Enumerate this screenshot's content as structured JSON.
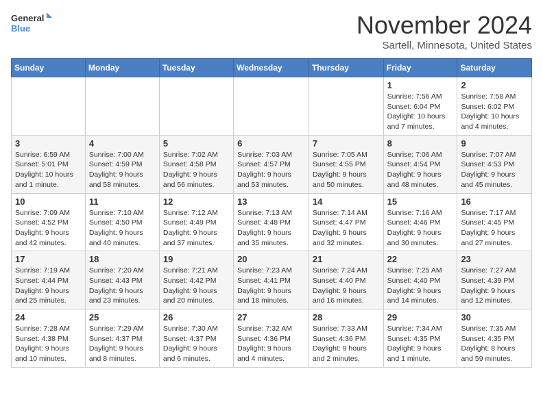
{
  "header": {
    "logo_general": "General",
    "logo_blue": "Blue",
    "month_title": "November 2024",
    "location": "Sartell, Minnesota, United States"
  },
  "days_of_week": [
    "Sunday",
    "Monday",
    "Tuesday",
    "Wednesday",
    "Thursday",
    "Friday",
    "Saturday"
  ],
  "weeks": [
    [
      {
        "num": "",
        "info": ""
      },
      {
        "num": "",
        "info": ""
      },
      {
        "num": "",
        "info": ""
      },
      {
        "num": "",
        "info": ""
      },
      {
        "num": "",
        "info": ""
      },
      {
        "num": "1",
        "info": "Sunrise: 7:56 AM\nSunset: 6:04 PM\nDaylight: 10 hours and 7 minutes."
      },
      {
        "num": "2",
        "info": "Sunrise: 7:58 AM\nSunset: 6:02 PM\nDaylight: 10 hours and 4 minutes."
      }
    ],
    [
      {
        "num": "3",
        "info": "Sunrise: 6:59 AM\nSunset: 5:01 PM\nDaylight: 10 hours and 1 minute."
      },
      {
        "num": "4",
        "info": "Sunrise: 7:00 AM\nSunset: 4:59 PM\nDaylight: 9 hours and 58 minutes."
      },
      {
        "num": "5",
        "info": "Sunrise: 7:02 AM\nSunset: 4:58 PM\nDaylight: 9 hours and 56 minutes."
      },
      {
        "num": "6",
        "info": "Sunrise: 7:03 AM\nSunset: 4:57 PM\nDaylight: 9 hours and 53 minutes."
      },
      {
        "num": "7",
        "info": "Sunrise: 7:05 AM\nSunset: 4:55 PM\nDaylight: 9 hours and 50 minutes."
      },
      {
        "num": "8",
        "info": "Sunrise: 7:06 AM\nSunset: 4:54 PM\nDaylight: 9 hours and 48 minutes."
      },
      {
        "num": "9",
        "info": "Sunrise: 7:07 AM\nSunset: 4:53 PM\nDaylight: 9 hours and 45 minutes."
      }
    ],
    [
      {
        "num": "10",
        "info": "Sunrise: 7:09 AM\nSunset: 4:52 PM\nDaylight: 9 hours and 42 minutes."
      },
      {
        "num": "11",
        "info": "Sunrise: 7:10 AM\nSunset: 4:50 PM\nDaylight: 9 hours and 40 minutes."
      },
      {
        "num": "12",
        "info": "Sunrise: 7:12 AM\nSunset: 4:49 PM\nDaylight: 9 hours and 37 minutes."
      },
      {
        "num": "13",
        "info": "Sunrise: 7:13 AM\nSunset: 4:48 PM\nDaylight: 9 hours and 35 minutes."
      },
      {
        "num": "14",
        "info": "Sunrise: 7:14 AM\nSunset: 4:47 PM\nDaylight: 9 hours and 32 minutes."
      },
      {
        "num": "15",
        "info": "Sunrise: 7:16 AM\nSunset: 4:46 PM\nDaylight: 9 hours and 30 minutes."
      },
      {
        "num": "16",
        "info": "Sunrise: 7:17 AM\nSunset: 4:45 PM\nDaylight: 9 hours and 27 minutes."
      }
    ],
    [
      {
        "num": "17",
        "info": "Sunrise: 7:19 AM\nSunset: 4:44 PM\nDaylight: 9 hours and 25 minutes."
      },
      {
        "num": "18",
        "info": "Sunrise: 7:20 AM\nSunset: 4:43 PM\nDaylight: 9 hours and 23 minutes."
      },
      {
        "num": "19",
        "info": "Sunrise: 7:21 AM\nSunset: 4:42 PM\nDaylight: 9 hours and 20 minutes."
      },
      {
        "num": "20",
        "info": "Sunrise: 7:23 AM\nSunset: 4:41 PM\nDaylight: 9 hours and 18 minutes."
      },
      {
        "num": "21",
        "info": "Sunrise: 7:24 AM\nSunset: 4:40 PM\nDaylight: 9 hours and 16 minutes."
      },
      {
        "num": "22",
        "info": "Sunrise: 7:25 AM\nSunset: 4:40 PM\nDaylight: 9 hours and 14 minutes."
      },
      {
        "num": "23",
        "info": "Sunrise: 7:27 AM\nSunset: 4:39 PM\nDaylight: 9 hours and 12 minutes."
      }
    ],
    [
      {
        "num": "24",
        "info": "Sunrise: 7:28 AM\nSunset: 4:38 PM\nDaylight: 9 hours and 10 minutes."
      },
      {
        "num": "25",
        "info": "Sunrise: 7:29 AM\nSunset: 4:37 PM\nDaylight: 9 hours and 8 minutes."
      },
      {
        "num": "26",
        "info": "Sunrise: 7:30 AM\nSunset: 4:37 PM\nDaylight: 9 hours and 6 minutes."
      },
      {
        "num": "27",
        "info": "Sunrise: 7:32 AM\nSunset: 4:36 PM\nDaylight: 9 hours and 4 minutes."
      },
      {
        "num": "28",
        "info": "Sunrise: 7:33 AM\nSunset: 4:36 PM\nDaylight: 9 hours and 2 minutes."
      },
      {
        "num": "29",
        "info": "Sunrise: 7:34 AM\nSunset: 4:35 PM\nDaylight: 9 hours and 1 minute."
      },
      {
        "num": "30",
        "info": "Sunrise: 7:35 AM\nSunset: 4:35 PM\nDaylight: 8 hours and 59 minutes."
      }
    ]
  ]
}
